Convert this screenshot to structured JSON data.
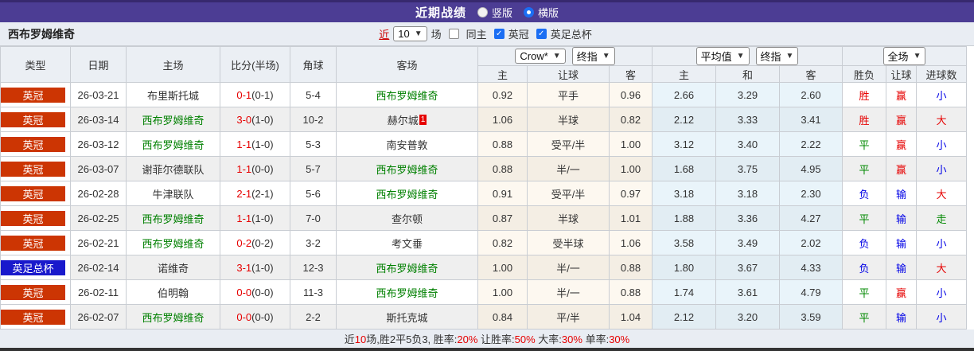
{
  "topbar": {
    "title": "近期战绩",
    "view_options": [
      {
        "label": "竖版",
        "selected": false
      },
      {
        "label": "横版",
        "selected": true
      }
    ]
  },
  "filter": {
    "team_name": "西布罗姆维奇",
    "recent_label": "近",
    "count_value": "10",
    "games_label": "场",
    "checkboxes": [
      {
        "label": "同主",
        "checked": false
      },
      {
        "label": "英冠",
        "checked": true
      },
      {
        "label": "英足总杯",
        "checked": true
      }
    ]
  },
  "selectors": {
    "odds_company": "Crow*",
    "odds_stage": "终指",
    "europe_company": "平均值",
    "europe_stage": "终指",
    "scope": "全场"
  },
  "table": {
    "columns": [
      "类型",
      "日期",
      "主场",
      "比分(半场)",
      "角球",
      "客场"
    ],
    "sub_columns": [
      "主",
      "让球",
      "客",
      "主",
      "和",
      "客",
      "胜负",
      "让球",
      "进球数"
    ],
    "rows": [
      {
        "type": "英冠",
        "type_color": "red",
        "date": "26-03-21",
        "home": "布里斯托城",
        "home_green": false,
        "ft": "0-1",
        "ht": "(0-1)",
        "corner": "5-4",
        "away": "西布罗姆维奇",
        "away_green": true,
        "away_badge": "",
        "odds": [
          "0.92",
          "平手",
          "0.96"
        ],
        "avg": [
          "2.66",
          "3.29",
          "2.60"
        ],
        "results": [
          "胜",
          "赢",
          "小"
        ],
        "result_colors": [
          "red",
          "red",
          "blue"
        ]
      },
      {
        "type": "英冠",
        "type_color": "red",
        "date": "26-03-14",
        "home": "西布罗姆维奇",
        "home_green": true,
        "ft": "3-0",
        "ht": "(1-0)",
        "corner": "10-2",
        "away": "赫尔城",
        "away_green": false,
        "away_badge": "1",
        "odds": [
          "1.06",
          "半球",
          "0.82"
        ],
        "avg": [
          "2.12",
          "3.33",
          "3.41"
        ],
        "results": [
          "胜",
          "赢",
          "大"
        ],
        "result_colors": [
          "red",
          "red",
          "red"
        ]
      },
      {
        "type": "英冠",
        "type_color": "red",
        "date": "26-03-12",
        "home": "西布罗姆维奇",
        "home_green": true,
        "ft": "1-1",
        "ht": "(1-0)",
        "corner": "5-3",
        "away": "南安普敦",
        "away_green": false,
        "away_badge": "",
        "odds": [
          "0.88",
          "受平/半",
          "1.00"
        ],
        "avg": [
          "3.12",
          "3.40",
          "2.22"
        ],
        "results": [
          "平",
          "赢",
          "小"
        ],
        "result_colors": [
          "green",
          "red",
          "blue"
        ]
      },
      {
        "type": "英冠",
        "type_color": "red",
        "date": "26-03-07",
        "home": "谢菲尔德联队",
        "home_green": false,
        "ft": "1-1",
        "ht": "(0-0)",
        "corner": "5-7",
        "away": "西布罗姆维奇",
        "away_green": true,
        "away_badge": "",
        "odds": [
          "0.88",
          "半/一",
          "1.00"
        ],
        "avg": [
          "1.68",
          "3.75",
          "4.95"
        ],
        "results": [
          "平",
          "赢",
          "小"
        ],
        "result_colors": [
          "green",
          "red",
          "blue"
        ]
      },
      {
        "type": "英冠",
        "type_color": "red",
        "date": "26-02-28",
        "home": "牛津联队",
        "home_green": false,
        "ft": "2-1",
        "ht": "(2-1)",
        "corner": "5-6",
        "away": "西布罗姆维奇",
        "away_green": true,
        "away_badge": "",
        "odds": [
          "0.91",
          "受平/半",
          "0.97"
        ],
        "avg": [
          "3.18",
          "3.18",
          "2.30"
        ],
        "results": [
          "负",
          "输",
          "大"
        ],
        "result_colors": [
          "blue",
          "blue",
          "red"
        ]
      },
      {
        "type": "英冠",
        "type_color": "red",
        "date": "26-02-25",
        "home": "西布罗姆维奇",
        "home_green": true,
        "ft": "1-1",
        "ht": "(1-0)",
        "corner": "7-0",
        "away": "查尔顿",
        "away_green": false,
        "away_badge": "",
        "odds": [
          "0.87",
          "半球",
          "1.01"
        ],
        "avg": [
          "1.88",
          "3.36",
          "4.27"
        ],
        "results": [
          "平",
          "输",
          "走"
        ],
        "result_colors": [
          "green",
          "blue",
          "green"
        ]
      },
      {
        "type": "英冠",
        "type_color": "red",
        "date": "26-02-21",
        "home": "西布罗姆维奇",
        "home_green": true,
        "ft": "0-2",
        "ht": "(0-2)",
        "corner": "3-2",
        "away": "考文垂",
        "away_green": false,
        "away_badge": "",
        "odds": [
          "0.82",
          "受半球",
          "1.06"
        ],
        "avg": [
          "3.58",
          "3.49",
          "2.02"
        ],
        "results": [
          "负",
          "输",
          "小"
        ],
        "result_colors": [
          "blue",
          "blue",
          "blue"
        ]
      },
      {
        "type": "英足总杯",
        "type_color": "blue",
        "date": "26-02-14",
        "home": "诺维奇",
        "home_green": false,
        "ft": "3-1",
        "ht": "(1-0)",
        "corner": "12-3",
        "away": "西布罗姆维奇",
        "away_green": true,
        "away_badge": "",
        "odds": [
          "1.00",
          "半/一",
          "0.88"
        ],
        "avg": [
          "1.80",
          "3.67",
          "4.33"
        ],
        "results": [
          "负",
          "输",
          "大"
        ],
        "result_colors": [
          "blue",
          "blue",
          "red"
        ]
      },
      {
        "type": "英冠",
        "type_color": "red",
        "date": "26-02-11",
        "home": "伯明翰",
        "home_green": false,
        "ft": "0-0",
        "ht": "(0-0)",
        "corner": "11-3",
        "away": "西布罗姆维奇",
        "away_green": true,
        "away_badge": "",
        "odds": [
          "1.00",
          "半/一",
          "0.88"
        ],
        "avg": [
          "1.74",
          "3.61",
          "4.79"
        ],
        "results": [
          "平",
          "赢",
          "小"
        ],
        "result_colors": [
          "green",
          "red",
          "blue"
        ]
      },
      {
        "type": "英冠",
        "type_color": "red",
        "date": "26-02-07",
        "home": "西布罗姆维奇",
        "home_green": true,
        "ft": "0-0",
        "ht": "(0-0)",
        "corner": "2-2",
        "away": "斯托克城",
        "away_green": false,
        "away_badge": "",
        "odds": [
          "0.84",
          "平/半",
          "1.04"
        ],
        "avg": [
          "2.12",
          "3.20",
          "3.59"
        ],
        "results": [
          "平",
          "输",
          "小"
        ],
        "result_colors": [
          "green",
          "blue",
          "blue"
        ]
      }
    ]
  },
  "summary": {
    "parts": [
      {
        "text": "近",
        "color": "dark"
      },
      {
        "text": "10",
        "color": "red"
      },
      {
        "text": "场,胜2平5负3, 胜率:",
        "color": "dark"
      },
      {
        "text": "20%",
        "color": "red"
      },
      {
        "text": " 让胜率:",
        "color": "dark"
      },
      {
        "text": "50%",
        "color": "red"
      },
      {
        "text": " 大率:",
        "color": "dark"
      },
      {
        "text": "30%",
        "color": "red"
      },
      {
        "text": " 单率:",
        "color": "dark"
      },
      {
        "text": "30%",
        "color": "red"
      }
    ]
  }
}
